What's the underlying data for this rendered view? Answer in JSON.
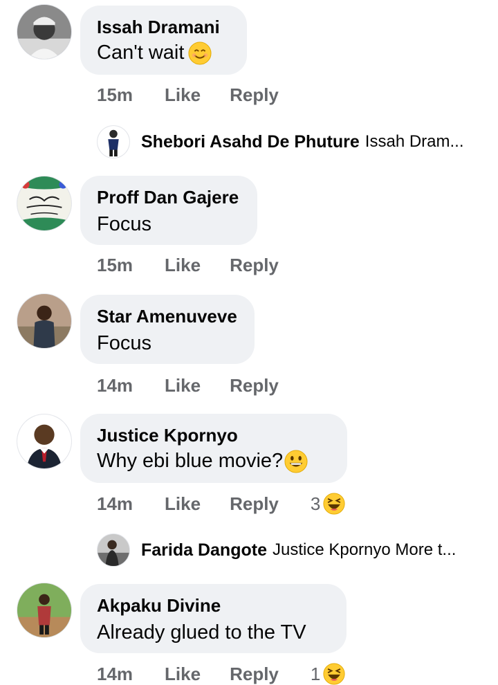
{
  "comments": [
    {
      "name": "Issah Dramani",
      "text": "Can't wait",
      "emoji": "smiling-face",
      "time": "15m",
      "like": "Like",
      "reply": "Reply"
    },
    {
      "name": "Proff Dan Gajere",
      "text": "Focus",
      "time": "15m",
      "like": "Like",
      "reply": "Reply"
    },
    {
      "name": "Star Amenuveve",
      "text": "Focus",
      "time": "14m",
      "like": "Like",
      "reply": "Reply"
    },
    {
      "name": "Justice Kpornyo",
      "text": "Why ebi blue movie?",
      "emoji": "grinning-face",
      "time": "14m",
      "like": "Like",
      "reply": "Reply",
      "reaction_count": "3",
      "reaction": "laughing-face"
    },
    {
      "name": "Akpaku Divine",
      "text": "Already glued to the TV",
      "time": "14m",
      "like": "Like",
      "reply": "Reply",
      "reaction_count": "1",
      "reaction": "laughing-face"
    }
  ],
  "replies": [
    {
      "name": "Shebori Asahd De Phuture",
      "preview": "Issah Dram..."
    },
    {
      "name": "Farida Dangote",
      "preview": "Justice Kpornyo More t..."
    }
  ],
  "colors": {
    "bubble": "#eff1f4",
    "meta": "#65676b",
    "text": "#050505",
    "emoji": "#ffcc33"
  }
}
